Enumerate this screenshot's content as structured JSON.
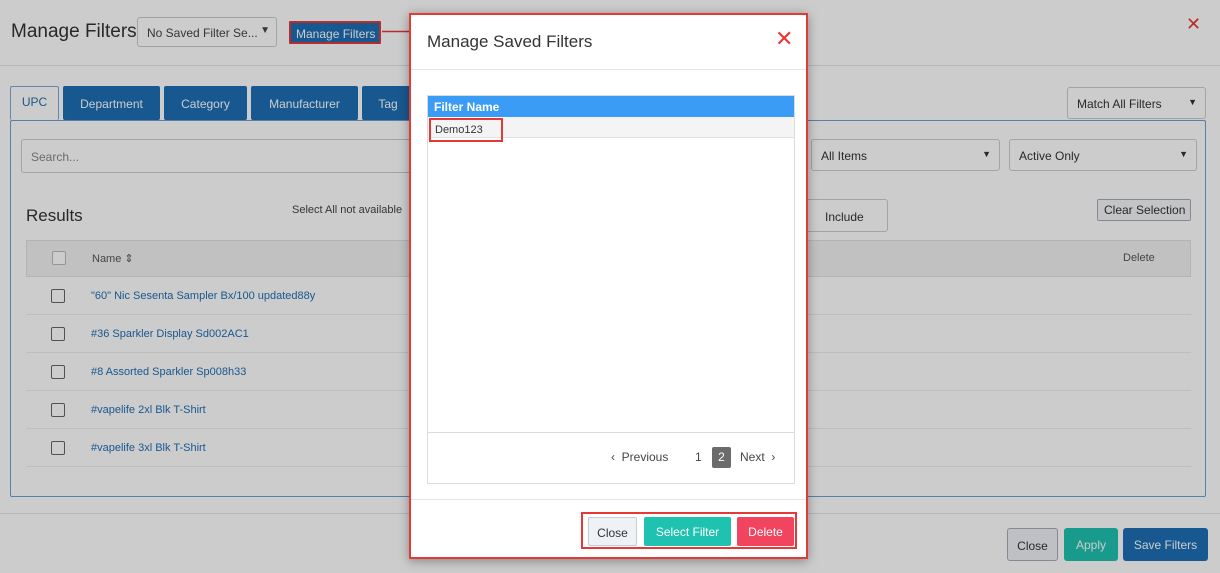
{
  "background_page": {
    "title": "Manage Filters",
    "saved_filter_select": "No Saved Filter Se...",
    "manage_filters_button": "Manage Filters",
    "tabs": [
      "UPC",
      "Department",
      "Category",
      "Manufacturer",
      "Tag"
    ],
    "match_select": "Match All Filters",
    "search_placeholder": "Search...",
    "items_select": "All Items",
    "status_select": "Active Only",
    "results_title": "Results",
    "select_all_note": "Select All not available",
    "include_button": "Include",
    "clear_selection_button": "Clear Selection",
    "table_headers": {
      "name": "Name ⇕",
      "delete": "Delete"
    },
    "rows": [
      "\"60\" Nic Sesenta Sampler Bx/100 updated88y",
      "#36 Sparkler Display Sd002AC1",
      "#8 Assorted Sparkler Sp008h33",
      "#vapelife 2xl Blk T-Shirt",
      "#vapelife 3xl Blk T-Shirt"
    ],
    "footer_buttons": {
      "close": "Close",
      "apply": "Apply",
      "save": "Save Filters"
    }
  },
  "modal": {
    "title": "Manage Saved Filters",
    "column_header": "Filter Name",
    "filters": [
      "Demo123"
    ],
    "pager": {
      "previous": "Previous",
      "page_1": "1",
      "page_2": "2",
      "next": "Next"
    },
    "buttons": {
      "close": "Close",
      "select": "Select Filter",
      "delete": "Delete"
    }
  },
  "colors": {
    "primary": "#1f6fb5",
    "teal": "#1fc1b0",
    "danger": "#f0445f",
    "highlight": "#e53935",
    "grid_header": "#3b9cf5"
  }
}
